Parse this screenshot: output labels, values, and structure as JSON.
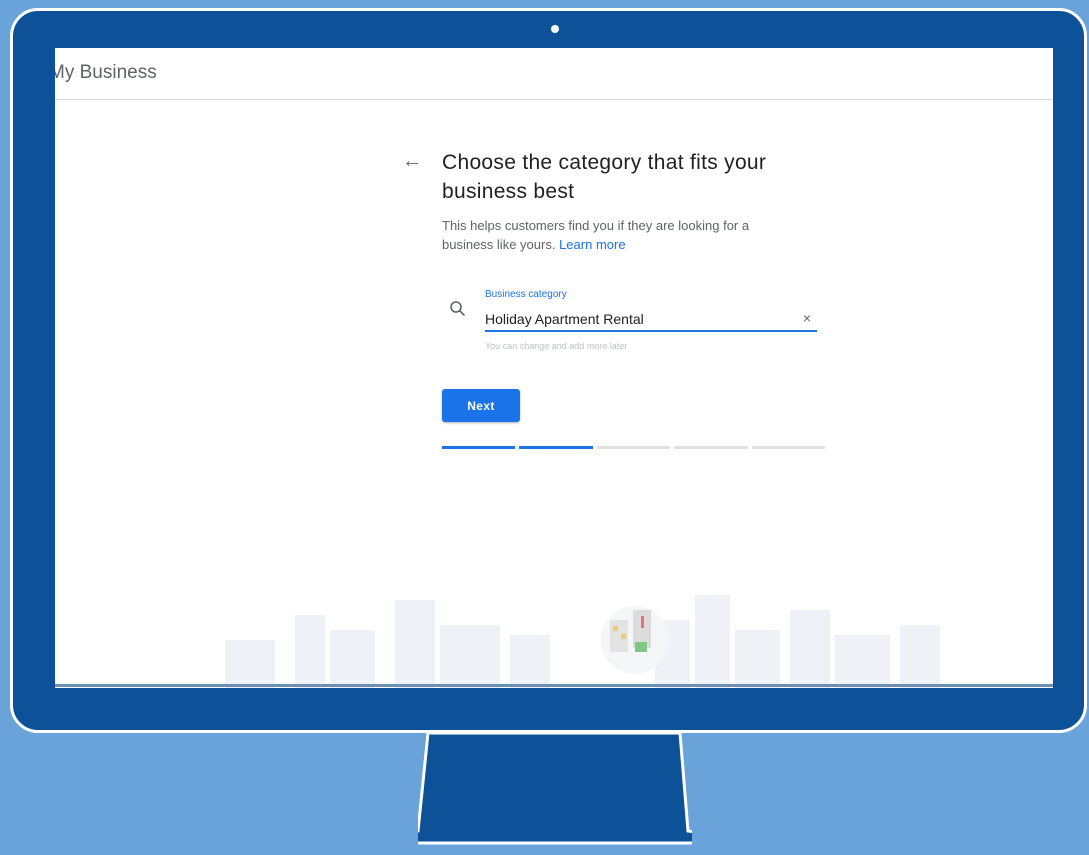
{
  "app": {
    "title": "My Business"
  },
  "page": {
    "heading": "Choose the category that fits your business best",
    "description": "This helps customers find you if they are looking for a business like yours.",
    "learn_more": "Learn more"
  },
  "category_field": {
    "label": "Business category",
    "value": "Holiday Apartment Rental",
    "helper": "You can change and add more later",
    "clear_icon": "close-icon",
    "search_icon": "search-icon"
  },
  "actions": {
    "next_label": "Next"
  },
  "progress": {
    "total_steps": 5,
    "completed_steps": 2
  },
  "colors": {
    "accent": "#1a73e8",
    "monitor": "#0d5298",
    "background": "#6aa3d9"
  }
}
